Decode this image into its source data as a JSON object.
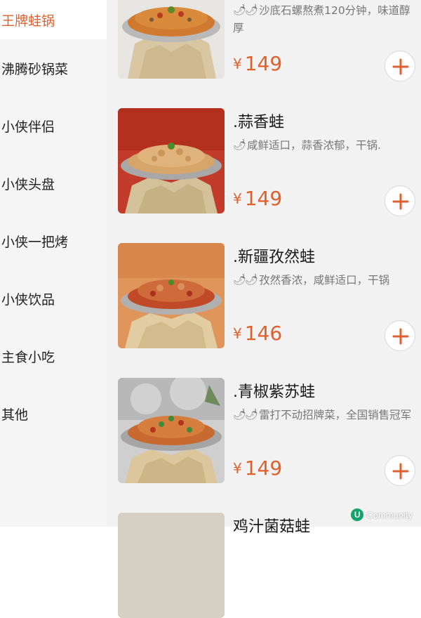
{
  "sidebar": {
    "items": [
      {
        "label": "王牌蛙锅",
        "active": true
      },
      {
        "label": "沸腾砂锅菜",
        "active": false
      },
      {
        "label": "小侠伴侣",
        "active": false
      },
      {
        "label": "小侠头盘",
        "active": false
      },
      {
        "label": "小侠一把烤",
        "active": false
      },
      {
        "label": "小侠饮品",
        "active": false
      },
      {
        "label": "主食小吃",
        "active": false
      },
      {
        "label": "其他",
        "active": false
      }
    ]
  },
  "menu": {
    "items": [
      {
        "name": "",
        "chili_count": 2,
        "desc": "沙底石螺熬煮120分钟，味道醇厚",
        "currency": "¥",
        "price": "149"
      },
      {
        "name": ".蒜香蛙",
        "chili_count": 1,
        "desc": "咸鲜适口，蒜香浓郁，干锅.",
        "currency": "¥",
        "price": "149"
      },
      {
        "name": ".新疆孜然蛙",
        "chili_count": 2,
        "desc": "孜然香浓，咸鲜适口，干锅",
        "currency": "¥",
        "price": "146"
      },
      {
        "name": ".青椒紫苏蛙",
        "chili_count": 2,
        "desc": "雷打不动招牌菜，全国销售冠军",
        "currency": "¥",
        "price": "149"
      },
      {
        "name": "鸡汁菌菇蛙",
        "chili_count": 0,
        "desc": "",
        "currency": "",
        "price": ""
      }
    ]
  },
  "colors": {
    "accent": "#e0602d",
    "sidebar_bg": "#f5f5f5",
    "main_bg": "#f2f2f2"
  },
  "watermark": {
    "text": "Community",
    "logo": "U"
  }
}
